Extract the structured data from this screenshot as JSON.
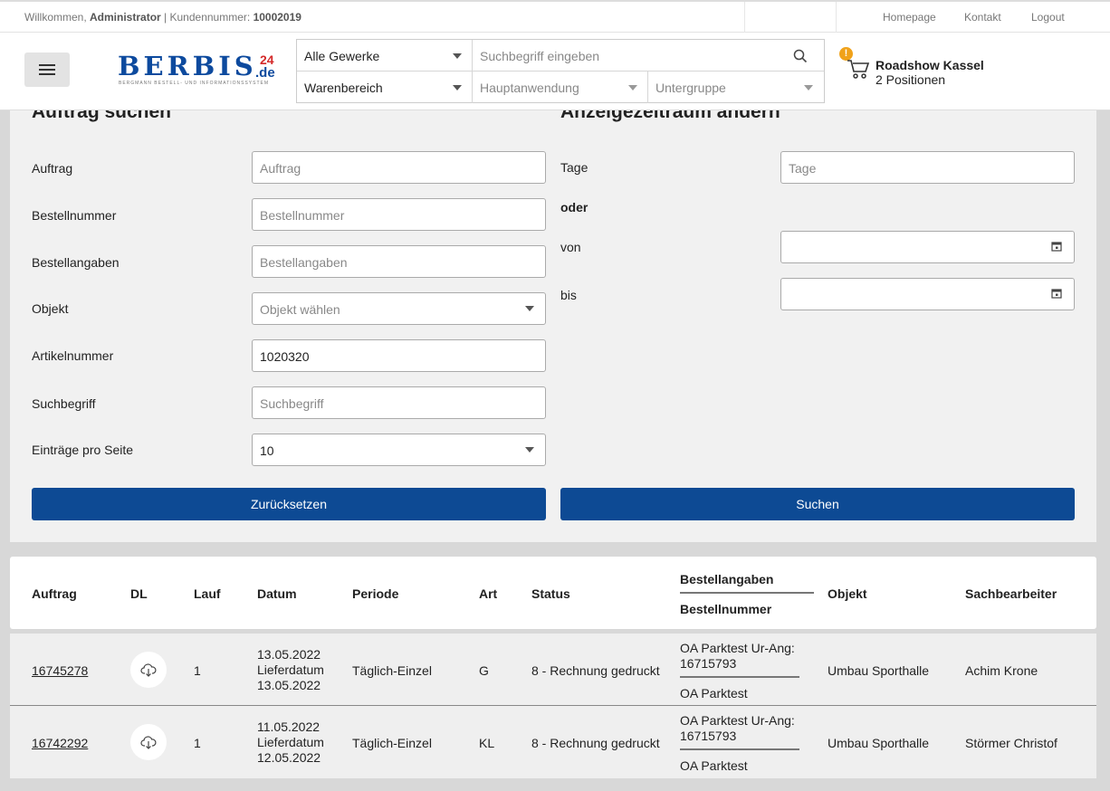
{
  "topbar": {
    "welcome_prefix": "Willkommen,",
    "user": "Administrator",
    "customer_label": "| Kundennummer:",
    "customer_number": "10002019",
    "links": [
      "Homepage",
      "Kontakt",
      "Logout"
    ]
  },
  "header": {
    "logo_text": "BERBIS",
    "logo_num": "24",
    "logo_tld": ".de",
    "logo_tagline": "BERGMANN BESTELL- UND INFORMATIONSSYSTEM",
    "search": {
      "gewerke": "Alle Gewerke",
      "placeholder": "Suchbegriff eingeben",
      "warenbereich": "Warenbereich",
      "hauptanwendung": "Hauptanwendung",
      "untergruppe": "Untergruppe"
    },
    "cart": {
      "badge": "!",
      "name": "Roadshow Kassel",
      "positions": "2 Positionen"
    }
  },
  "form": {
    "left_title": "Auftrag suchen",
    "right_title": "Anzeigezeitraum ändern",
    "fields": [
      {
        "label": "Auftrag",
        "placeholder": "Auftrag",
        "value": ""
      },
      {
        "label": "Bestellnummer",
        "placeholder": "Bestellnummer",
        "value": ""
      },
      {
        "label": "Bestellangaben",
        "placeholder": "Bestellangaben",
        "value": ""
      },
      {
        "label": "Objekt",
        "placeholder": "Objekt wählen",
        "value": ""
      },
      {
        "label": "Artikelnummer",
        "placeholder": "Artikelnummer",
        "value": "1020320"
      },
      {
        "label": "Suchbegriff",
        "placeholder": "Suchbegriff",
        "value": ""
      },
      {
        "label": "Einträge pro Seite",
        "placeholder": "",
        "value": "10"
      }
    ],
    "tage_label": "Tage",
    "tage_placeholder": "Tage",
    "oder": "oder",
    "von_label": "von",
    "bis_label": "bis",
    "reset_label": "Zurücksetzen",
    "search_label": "Suchen"
  },
  "table": {
    "headers": {
      "auftrag": "Auftrag",
      "dl": "DL",
      "lauf": "Lauf",
      "datum": "Datum",
      "periode": "Periode",
      "art": "Art",
      "status": "Status",
      "bestellangaben": "Bestellangaben",
      "bestellnummer": "Bestellnummer",
      "objekt": "Objekt",
      "sachbearbeiter": "Sachbearbeiter"
    },
    "rows": [
      {
        "auftrag": "16745278",
        "lauf": "1",
        "datum": "13.05.2022",
        "liefer_label": "Lieferdatum",
        "lieferdatum": "13.05.2022",
        "periode": "Täglich-Einzel",
        "art": "G",
        "status": "8 - Rechnung gedruckt",
        "bestellangaben_1": "OA Parktest Ur-Ang:",
        "bestellangaben_2": "16715793",
        "bestellnummer": "OA Parktest",
        "objekt": "Umbau Sporthalle",
        "sachbearbeiter": "Achim Krone"
      },
      {
        "auftrag": "16742292",
        "lauf": "1",
        "datum": "11.05.2022",
        "liefer_label": "Lieferdatum",
        "lieferdatum": "12.05.2022",
        "periode": "Täglich-Einzel",
        "art": "KL",
        "status": "8 - Rechnung gedruckt",
        "bestellangaben_1": "OA Parktest Ur-Ang:",
        "bestellangaben_2": "16715793",
        "bestellnummer": "OA Parktest",
        "objekt": "Umbau Sporthalle",
        "sachbearbeiter": "Störmer Christof"
      }
    ]
  },
  "colors": {
    "brand_blue": "#0d4a94",
    "logo_red": "#d42a2a",
    "badge_orange": "#f0a21a"
  }
}
